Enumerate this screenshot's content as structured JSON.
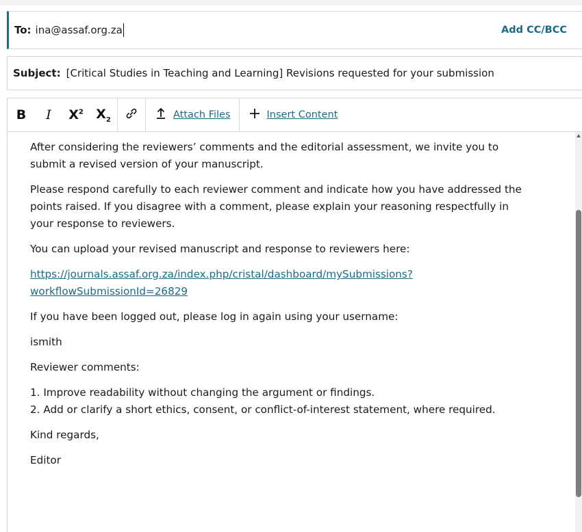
{
  "recipient": {
    "label": "To:",
    "value": "ina@assaf.org.za",
    "add_cc_label": "Add CC/BCC"
  },
  "subject": {
    "label": "Subject:",
    "value": "[Critical Studies in Teaching and Learning] Revisions requested for your submission"
  },
  "toolbar": {
    "bold": "B",
    "italic": "I",
    "superscript_base": "X",
    "superscript_mark": "2",
    "subscript_base": "X",
    "subscript_mark": "2",
    "attach_files_label": "Attach Files",
    "insert_content_label": "Insert Content"
  },
  "body": {
    "p1_l1": "After considering the reviewers’ comments and the editorial assessment, we invite you to",
    "p1_l2": "submit a revised version of your manuscript.",
    "p2_l1": "Please respond carefully to each reviewer comment and indicate how you have addressed the",
    "p2_l2": "points raised. If you disagree with a comment, please explain your reasoning respectfully in",
    "p2_l3": "your response to reviewers.",
    "p3": "You can upload your revised manuscript and response to reviewers here:",
    "link_l1": "https://journals.assaf.org.za/index.php/cristal/dashboard/mySubmissions?",
    "link_l2": "workflowSubmissionId=26829",
    "p4": "If you have been logged out, please log in again using your username:",
    "username": "ismith",
    "reviewer_heading": "Reviewer comments:",
    "comment_1": "1. Improve readability without changing the argument or findings.",
    "comment_2": "2. Add or clarify a short ethics, consent, or conflict-of-interest statement, where required.",
    "closing": "Kind regards,",
    "signature": "Editor"
  },
  "icons": {
    "link": "link-icon",
    "attach": "upload-arrow-icon",
    "insert": "plus-icon"
  }
}
